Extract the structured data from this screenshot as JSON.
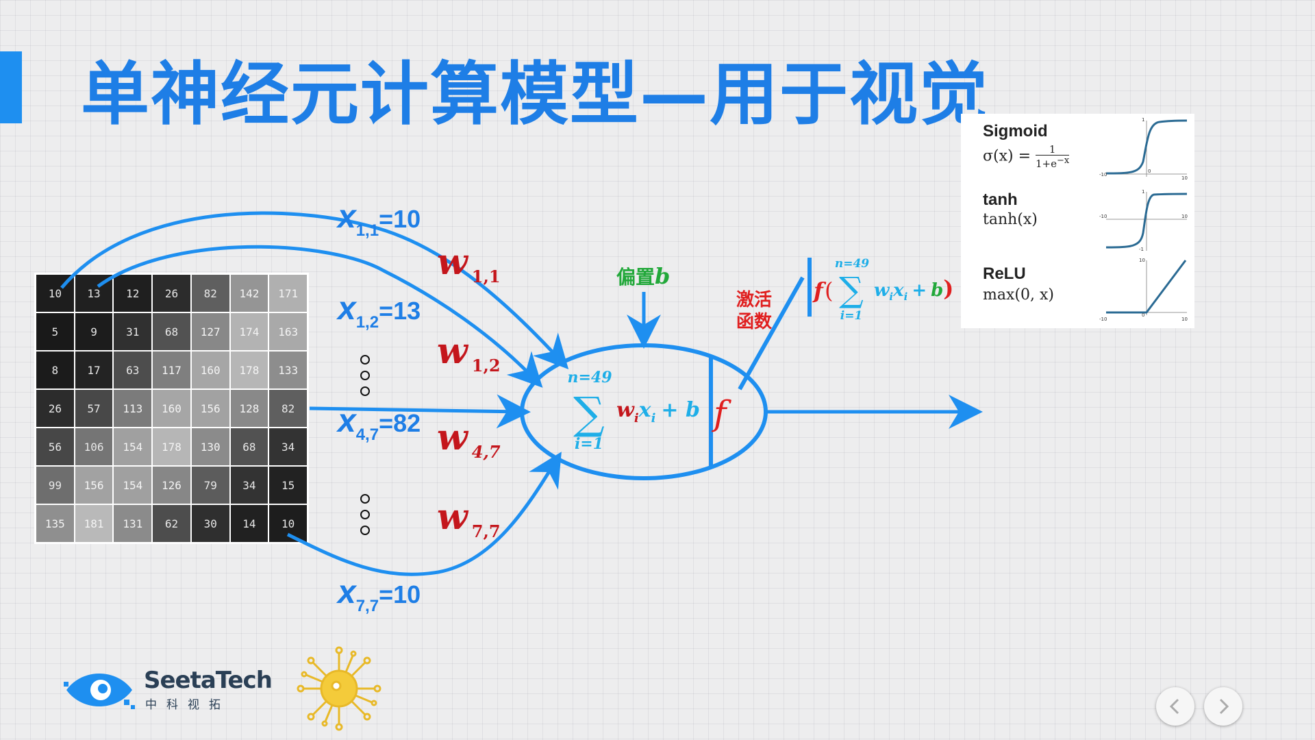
{
  "title": "单神经元计算模型—用于视觉",
  "pixel_matrix": [
    [
      10,
      13,
      12,
      26,
      82,
      142,
      171
    ],
    [
      5,
      9,
      31,
      68,
      127,
      174,
      163
    ],
    [
      8,
      17,
      63,
      117,
      160,
      178,
      133
    ],
    [
      26,
      57,
      113,
      160,
      156,
      128,
      82
    ],
    [
      56,
      106,
      154,
      178,
      130,
      68,
      34
    ],
    [
      99,
      156,
      154,
      126,
      79,
      34,
      15
    ],
    [
      135,
      181,
      131,
      62,
      30,
      14,
      10
    ]
  ],
  "inputs": [
    {
      "var": "x",
      "sub": "1,1",
      "eq": "=10"
    },
    {
      "var": "x",
      "sub": "1,2",
      "eq": "=13"
    },
    {
      "var": "x",
      "sub": "4,7",
      "eq": "=82"
    },
    {
      "var": "x",
      "sub": "7,7",
      "eq": "=10"
    }
  ],
  "weights": [
    {
      "var": "w",
      "sub": "1,1"
    },
    {
      "var": "w",
      "sub": "1,2"
    },
    {
      "var": "w",
      "sub": "4,7"
    },
    {
      "var": "w",
      "sub": "7,7"
    }
  ],
  "bias_label": "偏置",
  "bias_var": "b",
  "activation_label_line1": "激活",
  "activation_label_line2": "函数",
  "neuron": {
    "sum_upper": "n=49",
    "sum_lower": "i=1",
    "sum_symbol": "∑",
    "term_w": "w",
    "term_w_sub": "i",
    "term_x": "x",
    "term_x_sub": "i",
    "plus_b": "+ b",
    "f": "f"
  },
  "output_formula": {
    "f": "f",
    "open_paren": "(",
    "sum_upper": "n=49",
    "sum_lower": "i=1",
    "sum_symbol": "∑",
    "w": "w",
    "w_sub": "i",
    "x": "x",
    "x_sub": "i",
    "plus": "+",
    "b": "b",
    "close_paren": ")"
  },
  "activations": [
    {
      "name": "Sigmoid",
      "formula_lhs": "σ(x) = ",
      "formula_num": "1",
      "formula_den": "1+e",
      "formula_exp": "−x",
      "axis_min": "-10",
      "axis_max": "10",
      "y_max": "1",
      "y_min": "0"
    },
    {
      "name": "tanh",
      "formula": "tanh(x)",
      "axis_min": "-10",
      "axis_max": "10",
      "y_max": "1",
      "y_min": "-1"
    },
    {
      "name": "ReLU",
      "formula": "max(0, x)",
      "axis_min": "-10",
      "axis_max": "10",
      "y_max": "10",
      "y_min": "0"
    }
  ],
  "logo": {
    "text": "SeetaTech",
    "subtext": "中科视拓"
  },
  "colors": {
    "accent": "#1e8ff0",
    "title": "#1e7ee6",
    "weight": "#c4161c",
    "bias": "#22a83a",
    "formula": "#1eaee8",
    "activation_label": "#e01f1f",
    "neuron_stroke": "#1e8ff0"
  },
  "nav": {
    "prev_icon": "chevron-left-icon",
    "next_icon": "chevron-right-icon"
  }
}
